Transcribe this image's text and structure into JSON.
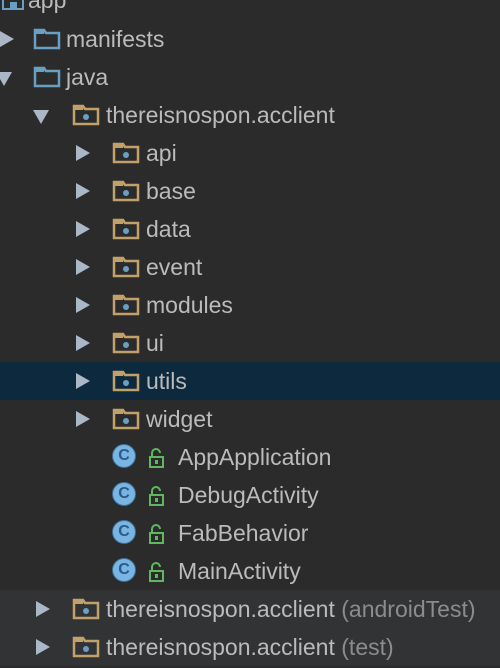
{
  "tree": {
    "root": {
      "label": "app",
      "icon": "module-folder-icon"
    },
    "items": [
      {
        "label": "manifests",
        "suffix": "",
        "icon": "source-folder-icon",
        "expanded": false
      },
      {
        "label": "java",
        "suffix": "",
        "icon": "source-folder-icon",
        "expanded": true
      },
      {
        "label": "thereisnospon.acclient",
        "suffix": "",
        "icon": "package-icon",
        "expanded": true
      },
      {
        "label": "api",
        "suffix": "",
        "icon": "package-icon",
        "expanded": false
      },
      {
        "label": "base",
        "suffix": "",
        "icon": "package-icon",
        "expanded": false
      },
      {
        "label": "data",
        "suffix": "",
        "icon": "package-icon",
        "expanded": false
      },
      {
        "label": "event",
        "suffix": "",
        "icon": "package-icon",
        "expanded": false
      },
      {
        "label": "modules",
        "suffix": "",
        "icon": "package-icon",
        "expanded": false
      },
      {
        "label": "ui",
        "suffix": "",
        "icon": "package-icon",
        "expanded": false
      },
      {
        "label": "utils",
        "suffix": "",
        "icon": "package-icon",
        "expanded": false,
        "selected": true
      },
      {
        "label": "widget",
        "suffix": "",
        "icon": "package-icon",
        "expanded": false
      },
      {
        "label": "AppApplication",
        "suffix": "",
        "icon": "class-icon"
      },
      {
        "label": "DebugActivity",
        "suffix": "",
        "icon": "class-icon"
      },
      {
        "label": "FabBehavior",
        "suffix": "",
        "icon": "class-icon"
      },
      {
        "label": "MainActivity",
        "suffix": "",
        "icon": "class-icon"
      },
      {
        "label": "thereisnospon.acclient",
        "suffix": "(androidTest)",
        "icon": "package-icon",
        "expanded": false
      },
      {
        "label": "thereisnospon.acclient",
        "suffix": "(test)",
        "icon": "package-icon",
        "expanded": false
      }
    ]
  },
  "colors": {
    "background": "#2b2b2b",
    "selection": "#0d293e",
    "text": "#bbbbbb",
    "suffix_text": "#8c8c8c",
    "folder_blue": "#6a9fc4",
    "package_tan": "#c2a06a",
    "class_circle": "#79b5e3",
    "lock_green": "#5fb85f"
  }
}
